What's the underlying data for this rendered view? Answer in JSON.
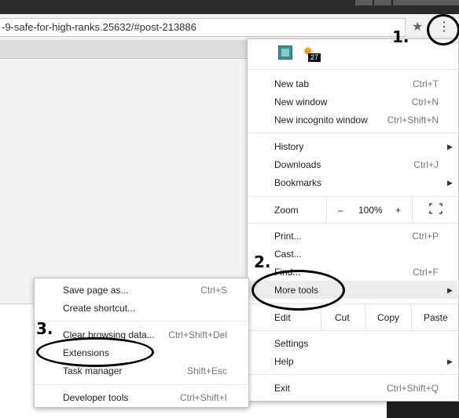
{
  "browser": {
    "url": "-9-safe-for-high-ranks.25632/#post-213886",
    "extension_badge": "27"
  },
  "menu": {
    "new_tab": {
      "label": "New tab",
      "shortcut": "Ctrl+T"
    },
    "new_window": {
      "label": "New window",
      "shortcut": "Ctrl+N"
    },
    "new_incognito": {
      "label": "New incognito window",
      "shortcut": "Ctrl+Shift+N"
    },
    "history": {
      "label": "History"
    },
    "downloads": {
      "label": "Downloads",
      "shortcut": "Ctrl+J"
    },
    "bookmarks": {
      "label": "Bookmarks"
    },
    "zoom": {
      "label": "Zoom",
      "minus": "–",
      "value": "100%",
      "plus": "+"
    },
    "print": {
      "label": "Print...",
      "shortcut": "Ctrl+P"
    },
    "cast": {
      "label": "Cast..."
    },
    "find": {
      "label": "Find...",
      "shortcut": "Ctrl+F"
    },
    "more_tools": {
      "label": "More tools"
    },
    "edit": {
      "label": "Edit",
      "cut": "Cut",
      "copy": "Copy",
      "paste": "Paste"
    },
    "settings": {
      "label": "Settings"
    },
    "help": {
      "label": "Help"
    },
    "exit": {
      "label": "Exit",
      "shortcut": "Ctrl+Shift+Q"
    }
  },
  "submenu": {
    "save_page": {
      "label": "Save page as...",
      "shortcut": "Ctrl+S"
    },
    "create_shortcut": {
      "label": "Create shortcut..."
    },
    "clear_data": {
      "label": "Clear browsing data...",
      "shortcut": "Ctrl+Shift+Del"
    },
    "extensions": {
      "label": "Extensions"
    },
    "task_manager": {
      "label": "Task manager",
      "shortcut": "Shift+Esc"
    },
    "dev_tools": {
      "label": "Developer tools",
      "shortcut": "Ctrl+Shift+I"
    }
  },
  "annotations": {
    "step1": "1.",
    "step2": "2.",
    "step3": "3."
  }
}
